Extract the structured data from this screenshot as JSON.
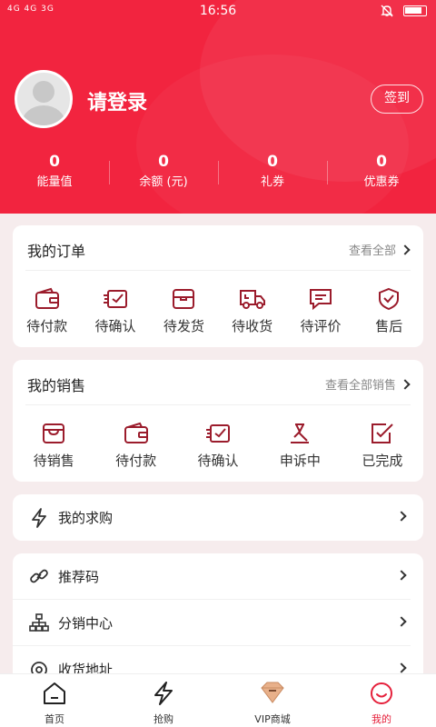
{
  "status_bar": {
    "network": "4G 4G 3G",
    "time": "16:56"
  },
  "profile": {
    "login_text": "请登录",
    "signin_label": "签到"
  },
  "stats": [
    {
      "value": "0",
      "label": "能量值"
    },
    {
      "value": "0",
      "label": "余额 (元)"
    },
    {
      "value": "0",
      "label": "礼券"
    },
    {
      "value": "0",
      "label": "优惠券"
    }
  ],
  "orders": {
    "title": "我的订单",
    "more": "查看全部",
    "items": [
      {
        "label": "待付款",
        "icon": "wallet-icon"
      },
      {
        "label": "待确认",
        "icon": "confirm-icon"
      },
      {
        "label": "待发货",
        "icon": "package-icon"
      },
      {
        "label": "待收货",
        "icon": "truck-icon"
      },
      {
        "label": "待评价",
        "icon": "comment-icon"
      },
      {
        "label": "售后",
        "icon": "shield-icon"
      }
    ]
  },
  "sales": {
    "title": "我的销售",
    "more": "查看全部销售",
    "items": [
      {
        "label": "待销售",
        "icon": "shop-icon"
      },
      {
        "label": "待付款",
        "icon": "wallet-icon"
      },
      {
        "label": "待确认",
        "icon": "confirm-icon"
      },
      {
        "label": "申诉中",
        "icon": "gavel-icon"
      },
      {
        "label": "已完成",
        "icon": "check-icon"
      }
    ]
  },
  "purchase": {
    "label": "我的求购",
    "icon": "lightning-icon"
  },
  "menu": [
    {
      "label": "推荐码",
      "icon": "link-icon"
    },
    {
      "label": "分销中心",
      "icon": "hierarchy-icon"
    },
    {
      "label": "收货地址",
      "icon": "location-icon"
    }
  ],
  "tabbar": [
    {
      "label": "首页",
      "icon": "home-icon"
    },
    {
      "label": "抢购",
      "icon": "lightning-icon"
    },
    {
      "label": "VIP商城",
      "icon": "diamond-icon"
    },
    {
      "label": "我的",
      "icon": "smile-icon"
    }
  ],
  "colors": {
    "brand": "#f2243f",
    "icon_red": "#9b1c2c",
    "active": "#e5203b"
  }
}
